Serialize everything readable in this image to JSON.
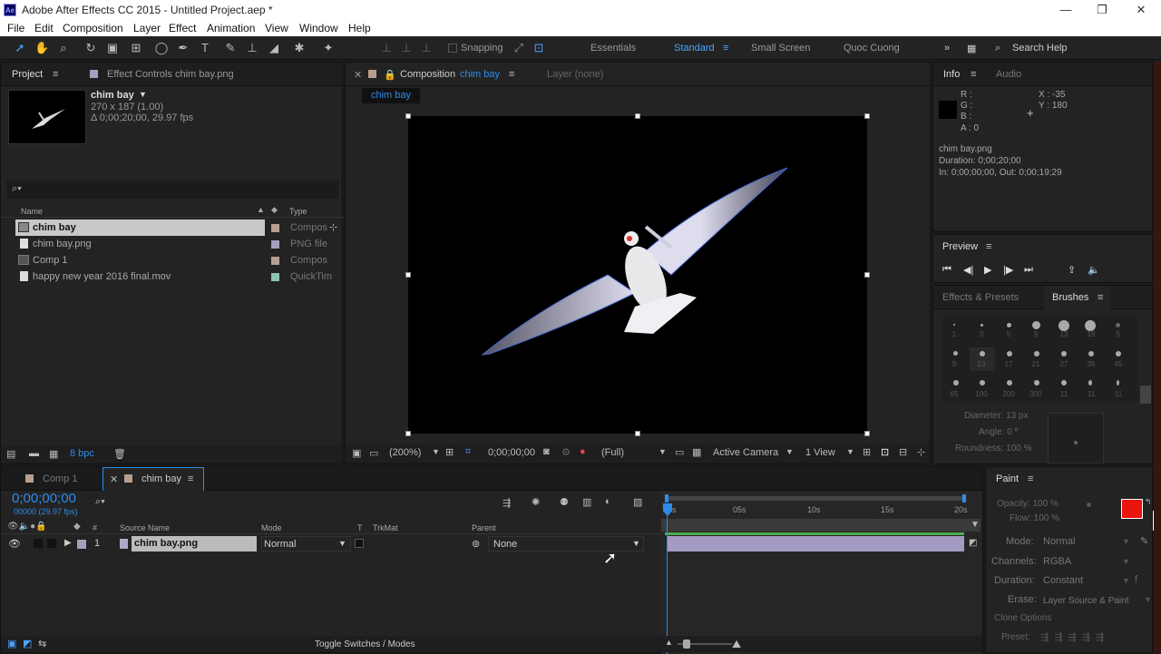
{
  "window": {
    "title": "Adobe After Effects CC 2015 - Untitled Project.aep *",
    "logo": "Ae",
    "min": "—",
    "max": "❐",
    "close": "✕"
  },
  "menu": [
    "File",
    "Edit",
    "Composition",
    "Layer",
    "Effect",
    "Animation",
    "View",
    "Window",
    "Help"
  ],
  "toolbar": {
    "snapping": "Snapping",
    "workspaces": [
      "Essentials",
      "Standard",
      "Small Screen",
      "Quoc Cuong"
    ],
    "active_workspace": "Standard",
    "search_help": "Search Help"
  },
  "project": {
    "tab_project": "Project",
    "tab_effects": "Effect Controls chim bay.png",
    "item_name": "chim bay",
    "item_size": "270 x 187 (1.00)",
    "item_duration": "Δ 0;00;20;00, 29.97 fps",
    "col_name": "Name",
    "col_type": "Type",
    "items": [
      {
        "name": "chim bay",
        "type": "Compos",
        "color": "#b69f8f"
      },
      {
        "name": "chim bay.png",
        "type": "PNG file",
        "color": "#a59fbf"
      },
      {
        "name": "Comp 1",
        "type": "Compos",
        "color": "#b69f8f"
      },
      {
        "name": "happy new year 2016 final.mov",
        "type": "QuickTim",
        "color": "#8fc2b5"
      }
    ],
    "bpc": "8 bpc"
  },
  "composition": {
    "tab_label": "Composition",
    "tab_comp": "chim bay",
    "tab_layer": "Layer (none)",
    "breadcrumb": "chim bay",
    "zoom": "(200%)",
    "timecode": "0;00;00;00",
    "resolution": "(Full)",
    "camera": "Active Camera",
    "views": "1 View"
  },
  "info": {
    "tab_info": "Info",
    "tab_audio": "Audio",
    "r": "R :",
    "g": "G :",
    "b": "B :",
    "a": "A : 0",
    "x": "X : -35",
    "y": "Y : 180",
    "name": "chim bay.png",
    "duration": "Duration: 0;00;20;00",
    "inout": "In: 0;00;00;00, Out: 0;00;19;29"
  },
  "preview": {
    "tab": "Preview"
  },
  "brushes": {
    "tab_effects": "Effects & Presets",
    "tab_brushes": "Brushes",
    "rows": [
      [
        "1",
        "3",
        "5",
        "9",
        "13",
        "19",
        "5"
      ],
      [
        "9",
        "13",
        "17",
        "21",
        "27",
        "35",
        "45"
      ],
      [
        "65",
        "100",
        "200",
        "300",
        "11",
        "11",
        "11"
      ]
    ],
    "diameter": "Diameter: 13 px",
    "angle": "Angle: 0 º",
    "roundness": "Roundness: 100 %"
  },
  "timeline": {
    "tab_comp1": "Comp 1",
    "tab_chimbay": "chim bay",
    "timecode": "0;00;00;00",
    "fps": "00000 (29.97 fps)",
    "col_source": "Source Name",
    "col_mode": "Mode",
    "col_t": "T",
    "col_trkmat": "TrkMat",
    "col_parent": "Parent",
    "layer": {
      "index": "1",
      "name": "chim bay.png",
      "mode": "Normal",
      "parent": "None"
    },
    "ticks": [
      "0s",
      "05s",
      "10s",
      "15s",
      "20s"
    ],
    "toggle": "Toggle Switches / Modes"
  },
  "paint": {
    "tab": "Paint",
    "opacity": "Opacity: 100 %",
    "flow": "Flow: 100 %",
    "mode_lbl": "Mode:",
    "mode": "Normal",
    "channels_lbl": "Channels:",
    "channels": "RGBA",
    "duration_lbl": "Duration:",
    "duration": "Constant",
    "erase_lbl": "Erase:",
    "erase": "Layer Source & Paint",
    "clone": "Clone Options",
    "preset": "Preset:",
    "fg_color": "#e8160e",
    "bg_color": "#ffffff"
  }
}
